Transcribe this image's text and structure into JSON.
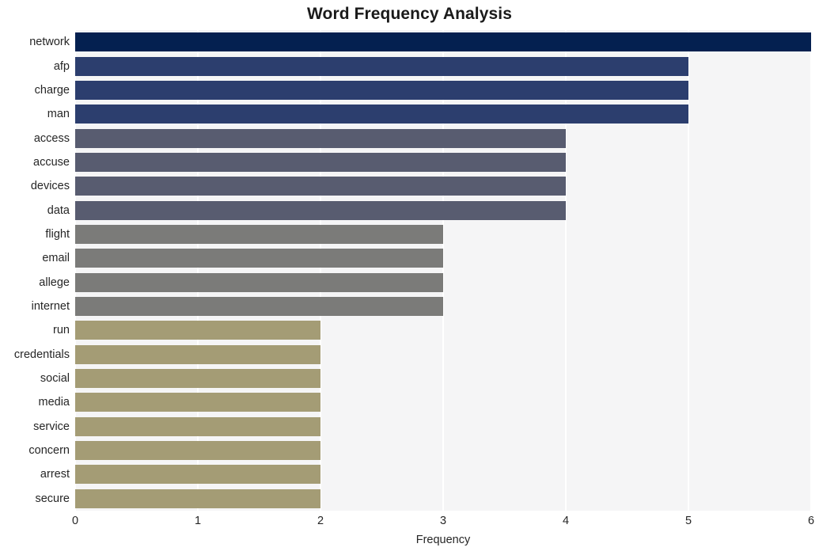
{
  "chart_data": {
    "type": "bar",
    "orientation": "horizontal",
    "title": "Word Frequency Analysis",
    "xlabel": "Frequency",
    "ylabel": "",
    "xlim": [
      0,
      6
    ],
    "xticks": [
      0,
      1,
      2,
      3,
      4,
      5,
      6
    ],
    "xtick_labels": [
      "0",
      "1",
      "2",
      "3",
      "4",
      "5",
      "6"
    ],
    "grid": true,
    "grid_axis": "x",
    "legend": "none",
    "plot_background": "#f5f5f6",
    "gridline_color": "#ffffff",
    "categories": [
      "network",
      "afp",
      "charge",
      "man",
      "access",
      "accuse",
      "devices",
      "data",
      "flight",
      "email",
      "allege",
      "internet",
      "run",
      "credentials",
      "social",
      "media",
      "service",
      "concern",
      "arrest",
      "secure"
    ],
    "values": [
      6,
      5,
      5,
      5,
      4,
      4,
      4,
      4,
      3,
      3,
      3,
      3,
      2,
      2,
      2,
      2,
      2,
      2,
      2,
      2
    ],
    "bar_colors": [
      "#042050",
      "#2c3e6e",
      "#2c3e6e",
      "#2c3e6e",
      "#585c70",
      "#585c70",
      "#585c70",
      "#585c70",
      "#7b7b79",
      "#7b7b79",
      "#7b7b79",
      "#7b7b79",
      "#a49c75",
      "#a49c75",
      "#a49c75",
      "#a49c75",
      "#a49c75",
      "#a49c75",
      "#a49c75",
      "#a49c75"
    ],
    "palette_name": "dark-navy-to-tan"
  }
}
